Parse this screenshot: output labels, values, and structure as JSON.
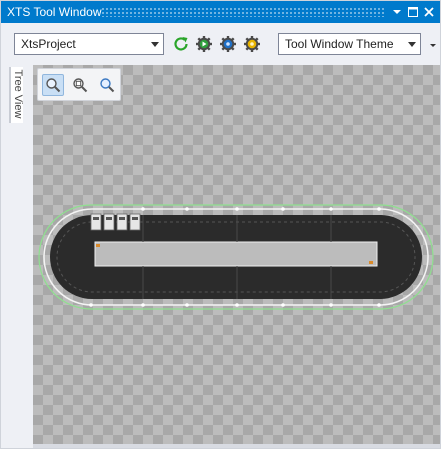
{
  "window": {
    "title": "XTS Tool Window",
    "accent_color": "#007acc",
    "controls": [
      "dropdown-arrow-icon",
      "maximize-icon",
      "close-icon"
    ]
  },
  "toolbar": {
    "project_combo": {
      "value": "XtsProject",
      "icon": "chevron-down-icon"
    },
    "buttons": [
      {
        "icon": "refresh-icon",
        "color": "#2aa52a"
      },
      {
        "icon": "gear-play-icon",
        "color": "#2e9e3c"
      },
      {
        "icon": "gear-blue-icon",
        "color": "#1f6fc5"
      },
      {
        "icon": "gear-yellow-icon",
        "color": "#e8b400"
      }
    ],
    "theme_combo": {
      "value": "Tool Window Theme",
      "icon": "chevron-down-icon"
    },
    "overflow_icon": "toolbar-overflow-icon"
  },
  "side_tabs": [
    {
      "label": "Tree View"
    }
  ],
  "zoom_tools": [
    {
      "icon": "zoom-fit-icon",
      "active": true
    },
    {
      "icon": "zoom-region-icon",
      "active": false
    },
    {
      "icon": "zoom-icon",
      "active": false
    }
  ],
  "track": {
    "type": "oval-track",
    "movers": 4,
    "track_color": "#333333",
    "outline_color": "#8fe08f"
  }
}
